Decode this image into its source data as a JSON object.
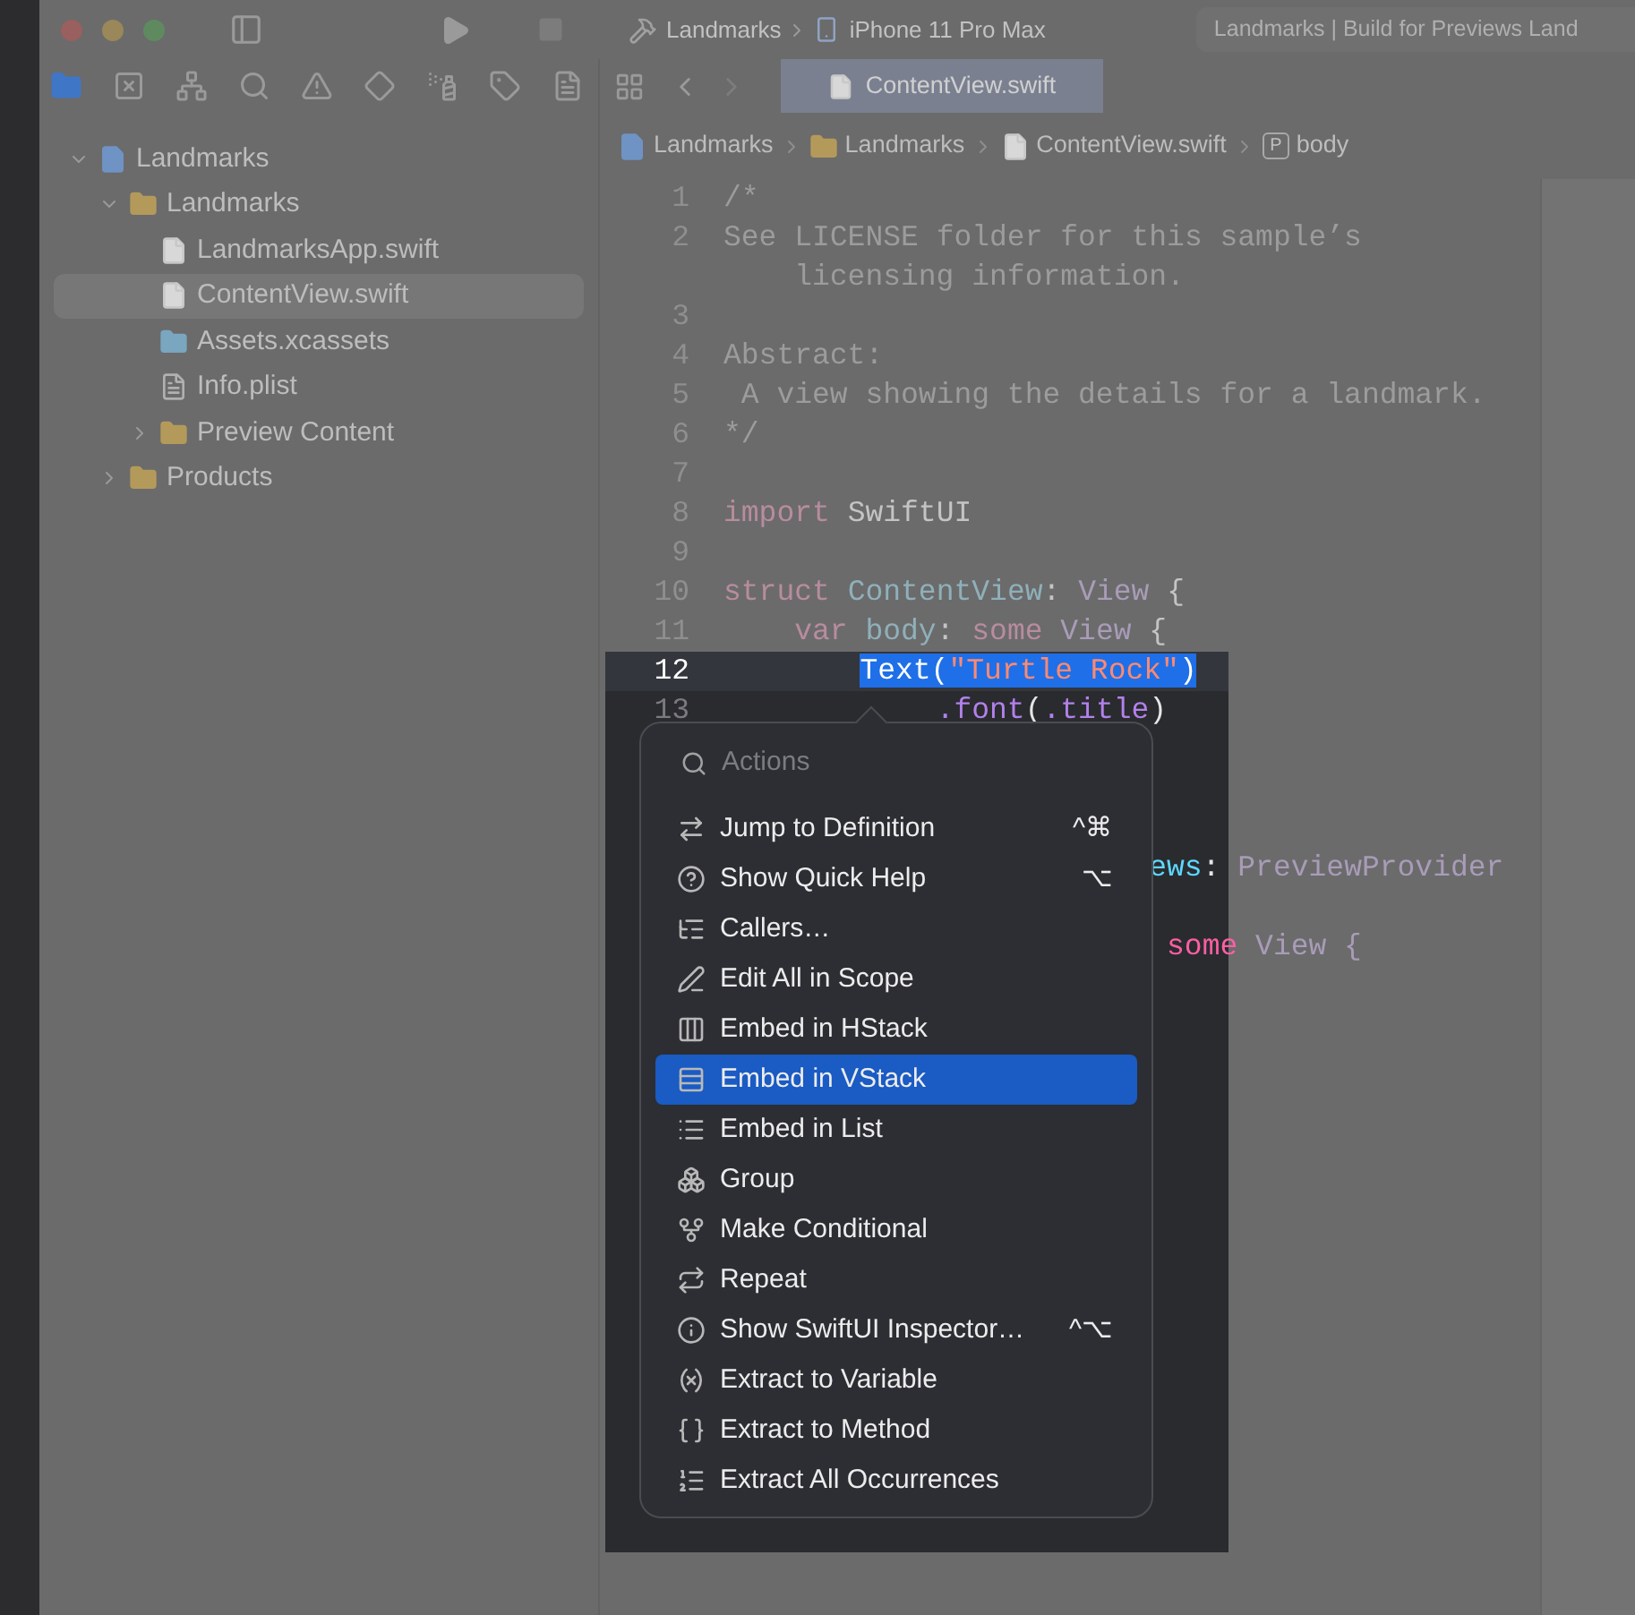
{
  "window": {
    "scheme": "Landmarks",
    "device": "iPhone 11 Pro Max",
    "status": "Landmarks | Build for Previews Land"
  },
  "editor_tabs": [
    {
      "label": "ContentView.swift",
      "selected": true
    }
  ],
  "breadcrumb": [
    {
      "label": "Landmarks",
      "kind": "project"
    },
    {
      "label": "Landmarks",
      "kind": "folder"
    },
    {
      "label": "ContentView.swift",
      "kind": "swift"
    },
    {
      "label": "body",
      "kind": "symbol",
      "badge": "P"
    }
  ],
  "navigator": [
    {
      "label": "Landmarks",
      "kind": "project",
      "expanded": true,
      "selected": false,
      "children": [
        {
          "label": "Landmarks",
          "kind": "folder",
          "expanded": true,
          "selected": false,
          "children": [
            {
              "label": "LandmarksApp.swift",
              "kind": "swift",
              "selected": false
            },
            {
              "label": "ContentView.swift",
              "kind": "swift",
              "selected": true
            },
            {
              "label": "Assets.xcassets",
              "kind": "assets",
              "selected": false
            },
            {
              "label": "Info.plist",
              "kind": "plist",
              "selected": false
            },
            {
              "label": "Preview Content",
              "kind": "folder",
              "expanded": false,
              "selected": false
            }
          ]
        },
        {
          "label": "Products",
          "kind": "folder",
          "expanded": false,
          "selected": false
        }
      ]
    }
  ],
  "code": [
    {
      "number": "1",
      "focus": false,
      "current": false,
      "tokens": [
        {
          "text": "/*",
          "kind": "comment"
        }
      ]
    },
    {
      "number": "2",
      "focus": false,
      "current": false,
      "tokens": [
        {
          "text": "See LICENSE folder for this sample’s",
          "kind": "comment"
        }
      ]
    },
    {
      "focus": false,
      "current": false,
      "tokens": [
        {
          "text": "    licensing information.",
          "kind": "comment"
        }
      ]
    },
    {
      "number": "3",
      "focus": false,
      "current": false
    },
    {
      "number": "4",
      "focus": false,
      "current": false,
      "tokens": [
        {
          "text": "Abstract:",
          "kind": "comment"
        }
      ]
    },
    {
      "number": "5",
      "focus": false,
      "current": false,
      "tokens": [
        {
          "text": " A view showing the details for a landmark.",
          "kind": "comment"
        }
      ]
    },
    {
      "number": "6",
      "focus": false,
      "current": false,
      "tokens": [
        {
          "text": "*/",
          "kind": "comment"
        }
      ]
    },
    {
      "number": "7",
      "focus": false,
      "current": false
    },
    {
      "number": "8",
      "focus": false,
      "current": false,
      "tokens": [
        {
          "text": "import",
          "kind": "keyword"
        },
        {
          "text": " SwiftUI",
          "kind": "plain"
        }
      ]
    },
    {
      "number": "9",
      "focus": false,
      "current": false
    },
    {
      "number": "10",
      "focus": false,
      "current": false,
      "tokens": [
        {
          "text": "struct",
          "kind": "keyword"
        },
        {
          "text": " ContentView",
          "kind": "decl"
        },
        {
          "text": ": ",
          "kind": "plain"
        },
        {
          "text": "View",
          "kind": "type"
        },
        {
          "text": " {",
          "kind": "plain"
        }
      ]
    },
    {
      "number": "11",
      "focus": false,
      "current": false,
      "tokens": [
        {
          "text": "    var",
          "kind": "keyword"
        },
        {
          "text": " body",
          "kind": "decl"
        },
        {
          "text": ": ",
          "kind": "plain"
        },
        {
          "text": "some",
          "kind": "keyword"
        },
        {
          "text": " View",
          "kind": "type"
        },
        {
          "text": " {",
          "kind": "plain"
        }
      ]
    },
    {
      "number": "12",
      "focus": true,
      "current": true,
      "tokens": [
        {
          "text": "Text(",
          "kind": "plain",
          "selected": true
        },
        {
          "text": "\"Turtle Rock\"",
          "kind": "string",
          "selected": true
        },
        {
          "text": ")",
          "kind": "plain",
          "selected": true
        }
      ]
    },
    {
      "number": "13",
      "focus": true,
      "current": false,
      "tokens": [
        {
          "text": "            .font",
          "kind": "func"
        },
        {
          "text": "(",
          "kind": "plain"
        },
        {
          "text": ".title",
          "kind": "func"
        },
        {
          "text": ")",
          "kind": "plain"
        }
      ]
    }
  ],
  "code_fragments": [
    {
      "tokens": [
        {
          "text": "ews",
          "kind": "decl",
          "focus": true
        },
        {
          "text": ": ",
          "kind": "plain",
          "focus": true
        },
        {
          "text": "PreviewProvider",
          "kind": "type",
          "focus": false
        }
      ]
    },
    {
      "tokens": [
        {
          "text": " some",
          "kind": "keyword",
          "focus": true
        },
        {
          "text": " View {",
          "kind": "type",
          "focus": false
        }
      ]
    }
  ],
  "actions_menu": {
    "placeholder": "Actions",
    "items": [
      {
        "label": "Jump to Definition",
        "shortcut": "^⌘",
        "selected": false
      },
      {
        "label": "Show Quick Help",
        "shortcut": "⌥",
        "selected": false
      },
      {
        "label": "Callers…",
        "selected": false
      },
      {
        "label": "Edit All in Scope",
        "selected": false
      },
      {
        "label": "Embed in HStack",
        "selected": false
      },
      {
        "label": "Embed in VStack",
        "selected": true
      },
      {
        "label": "Embed in List",
        "selected": false
      },
      {
        "label": "Group",
        "selected": false
      },
      {
        "label": "Make Conditional",
        "selected": false
      },
      {
        "label": "Repeat",
        "selected": false
      },
      {
        "label": "Show SwiftUI Inspector…",
        "shortcut": "^⌥",
        "selected": false
      },
      {
        "label": "Extract to Variable",
        "selected": false
      },
      {
        "label": "Extract to Method",
        "selected": false
      },
      {
        "label": "Extract All Occurrences",
        "selected": false
      }
    ]
  }
}
